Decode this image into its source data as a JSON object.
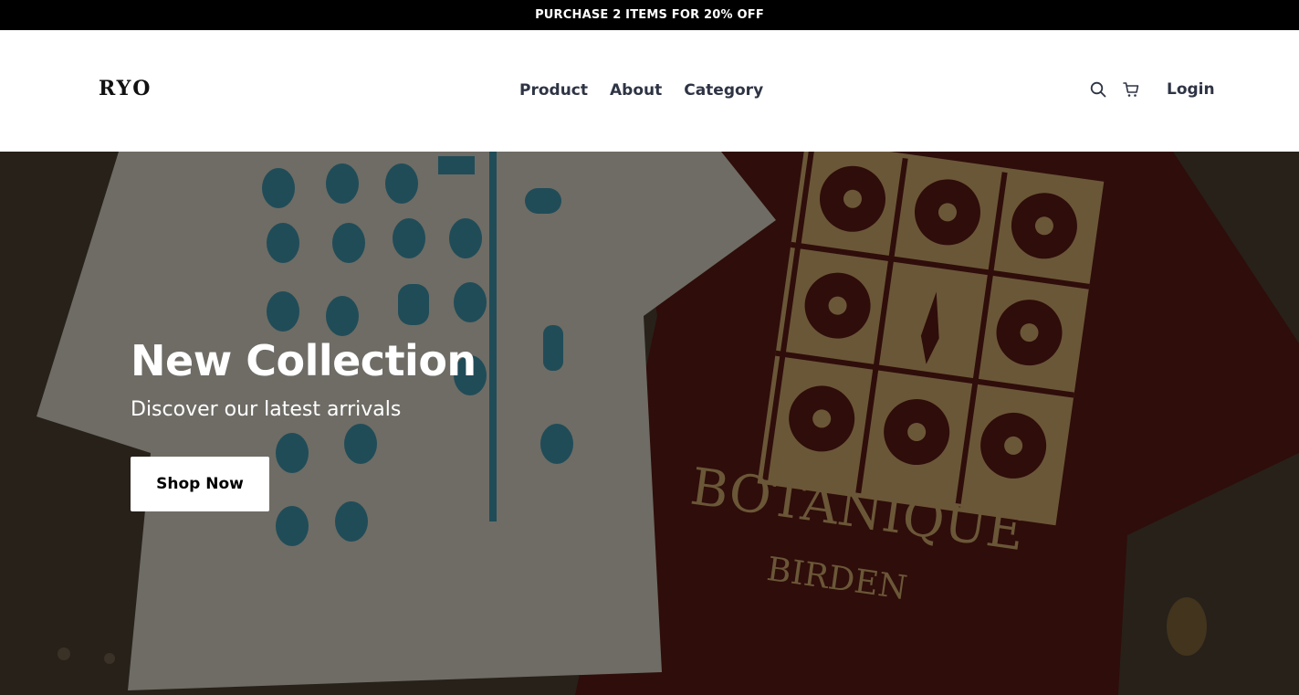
{
  "promo": {
    "text": "PURCHASE 2 ITEMS FOR 20% OFF"
  },
  "header": {
    "logo": "RYO",
    "nav": [
      {
        "label": "Product"
      },
      {
        "label": "About"
      },
      {
        "label": "Category"
      }
    ],
    "icons": [
      "search-icon",
      "cart-icon"
    ],
    "login_label": "Login"
  },
  "hero": {
    "title": "New Collection",
    "subtitle": "Discover our latest arrivals",
    "cta_label": "Shop Now",
    "image": {
      "left_shirt_print": "bird-hieroglyph-pattern",
      "right_shirt_print_line1": "BOTANIQUE",
      "right_shirt_print_line2": "BIRDEN"
    }
  },
  "colors": {
    "promo_bg": "#000000",
    "nav_text": "#2e3444",
    "left_shirt": "#cfcbbd",
    "glyph_teal": "#3d8fa5",
    "right_shirt": "#5a1a14",
    "print_tan": "#c8a46a",
    "floor": "#4a4033"
  }
}
